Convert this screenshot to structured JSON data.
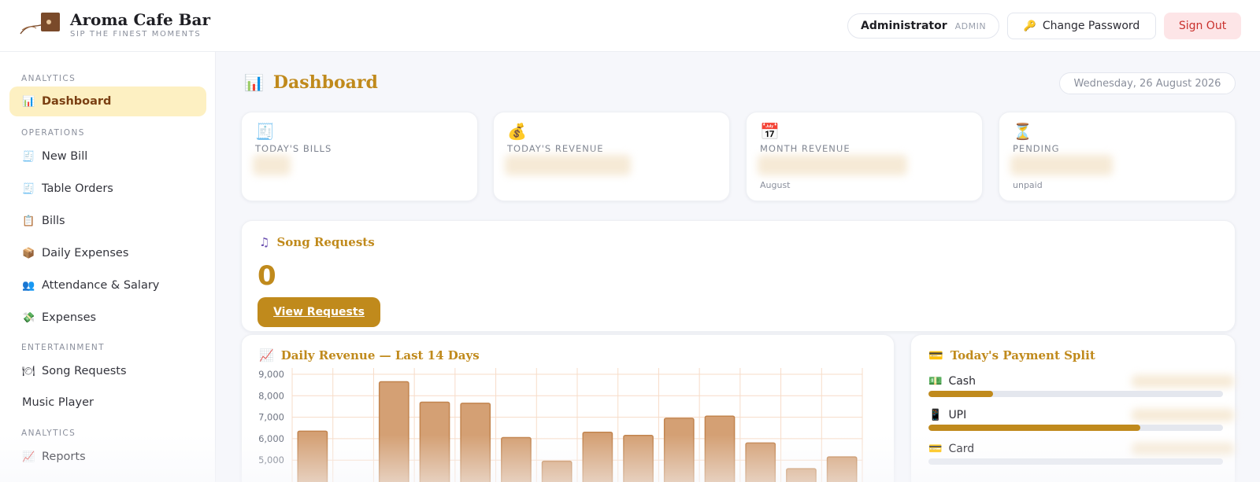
{
  "header": {
    "brand_name": "Aroma Cafe Bar",
    "brand_tagline": "SIP THE FINEST MOMENTS",
    "user_name": "Administrator",
    "user_role": "ADMIN",
    "change_password_label": "Change Password",
    "sign_out_label": "Sign Out"
  },
  "sidebar": {
    "sections": {
      "analytics_top": "ANALYTICS",
      "operations": "OPERATIONS",
      "entertainment": "ENTERTAINMENT",
      "analytics_bottom": "ANALYTICS"
    },
    "items": [
      {
        "label": "Dashboard",
        "icon": "bar-chart-icon",
        "active": true
      },
      {
        "label": "New Bill",
        "icon": "receipt-icon"
      },
      {
        "label": "Table Orders",
        "icon": "receipt-icon"
      },
      {
        "label": "Bills",
        "icon": "clipboard-icon"
      },
      {
        "label": "Daily Expenses",
        "icon": "package-icon"
      },
      {
        "label": "Attendance & Salary",
        "icon": "people-icon"
      },
      {
        "label": "Expenses",
        "icon": "money-wings-icon"
      },
      {
        "label": "Song Requests",
        "icon": "plate-icon"
      },
      {
        "label": "Music Player",
        "icon": ""
      },
      {
        "label": "Reports",
        "icon": "trend-chart-icon"
      }
    ]
  },
  "main": {
    "title": "Dashboard",
    "date": "Wednesday, 26 August 2026",
    "stats": [
      {
        "label": "TODAY'S BILLS",
        "sub": "",
        "icon": "receipt-icon"
      },
      {
        "label": "TODAY'S REVENUE",
        "sub": "",
        "icon": "money-bag-icon"
      },
      {
        "label": "MONTH REVENUE",
        "sub": "August",
        "icon": "calendar-icon"
      },
      {
        "label": "PENDING",
        "sub": "unpaid",
        "icon": "hourglass-icon"
      }
    ],
    "song_requests": {
      "title": "Song Requests",
      "count": "0",
      "button_label": "View Requests"
    },
    "revenue_panel": {
      "title": "Daily Revenue — Last 14 Days"
    },
    "payment_panel": {
      "title": "Today's Payment Split",
      "rows": [
        {
          "label": "Cash",
          "share": 0.22
        },
        {
          "label": "UPI",
          "share": 0.72
        },
        {
          "label": "Card",
          "share": 0.0
        }
      ]
    }
  },
  "colors": {
    "accent": "#c08a1c",
    "bar_fill": "#d4a074",
    "bar_stroke": "#c2844e",
    "active_bg": "#fdf0c2",
    "sign_out_bg": "#fde5e7",
    "sign_out_text": "#c9302c"
  },
  "chart_data": {
    "type": "bar",
    "title": "Daily Revenue — Last 14 Days",
    "xlabel": "",
    "ylabel": "",
    "ylim": [
      4000,
      9000
    ],
    "yticks": [
      5000,
      6000,
      7000,
      8000,
      9000
    ],
    "ytick_labels": [
      "5,000",
      "6,000",
      "7,000",
      "8,000",
      "9,000"
    ],
    "categories": [
      "",
      "",
      "",
      "",
      "",
      "",
      "",
      "",
      "",
      "",
      "",
      "",
      "",
      ""
    ],
    "values": [
      6350,
      null,
      8650,
      7700,
      7650,
      6050,
      4950,
      6300,
      6150,
      6950,
      7050,
      5800,
      4600,
      5150
    ],
    "grid": true
  }
}
